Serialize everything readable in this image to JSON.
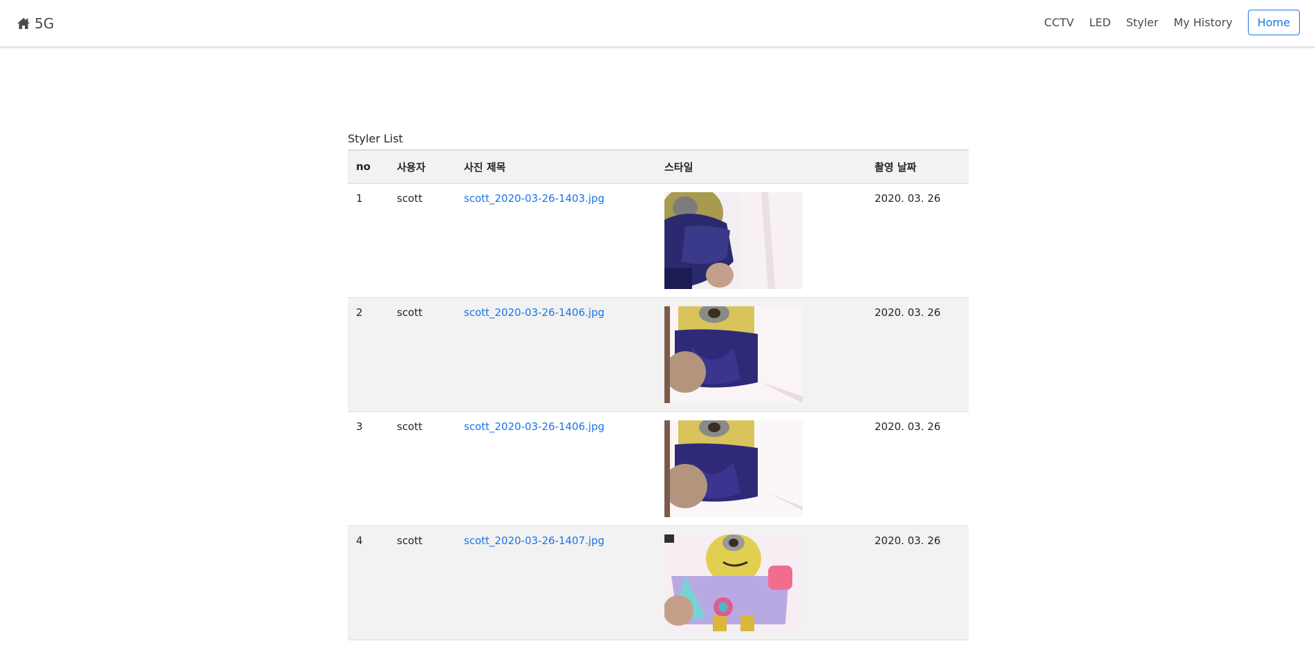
{
  "navbar": {
    "brand": "5G",
    "brand_icon": "home-icon",
    "links": [
      "CCTV",
      "LED",
      "Styler",
      "My History"
    ],
    "home_button": "Home",
    "accent": "#1a73e8"
  },
  "table": {
    "caption": "Styler List",
    "headers": [
      "no",
      "사용자",
      "사진 제목",
      "스타일",
      "촬영 날짜"
    ],
    "rows": [
      {
        "no": "1",
        "user": "scott",
        "title": "scott_2020-03-26-1403.jpg",
        "date": "2020. 03. 26"
      },
      {
        "no": "2",
        "user": "scott",
        "title": "scott_2020-03-26-1406.jpg",
        "date": "2020. 03. 26"
      },
      {
        "no": "3",
        "user": "scott",
        "title": "scott_2020-03-26-1406.jpg",
        "date": "2020. 03. 26"
      },
      {
        "no": "4",
        "user": "scott",
        "title": "scott_2020-03-26-1407.jpg",
        "date": "2020. 03. 26"
      }
    ]
  }
}
